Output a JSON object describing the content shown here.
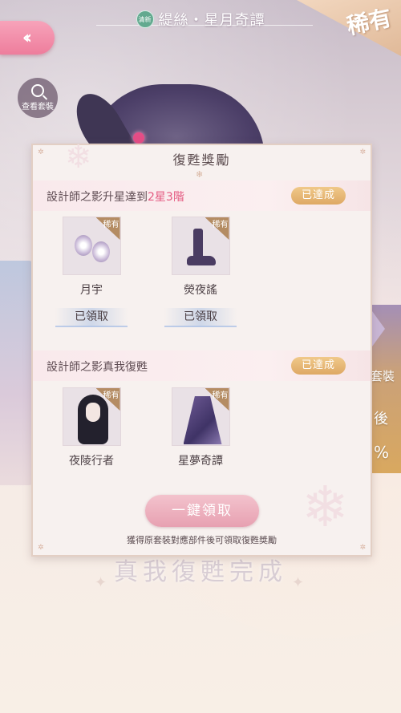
{
  "header": {
    "badge_label": "清新",
    "title": "緹絲・星月奇譚",
    "rarity_label": "稀有",
    "view_set_label": "查看套裝",
    "back_icon": "double-chevron-left-icon"
  },
  "background": {
    "right_labels": [
      "套裝",
      "後",
      "%"
    ],
    "bottom_text": "真我復甦完成"
  },
  "modal": {
    "title": "復甦獎勵",
    "sections": [
      {
        "title_prefix": "設計師之影升星達到",
        "title_highlight": "2星3階",
        "status": "已達成",
        "items": [
          {
            "name": "月宇",
            "rarity": "稀有",
            "claimed_label": "已領取",
            "icon": "earring-icon"
          },
          {
            "name": "熒夜謠",
            "rarity": "稀有",
            "claimed_label": "已領取",
            "icon": "boots-icon"
          }
        ]
      },
      {
        "title_prefix": "設計師之影真我復甦",
        "title_highlight": "",
        "status": "已達成",
        "items": [
          {
            "name": "夜陵行者",
            "rarity": "稀有",
            "icon": "hairstyle-icon"
          },
          {
            "name": "星夢奇譚",
            "rarity": "稀有",
            "icon": "dress-icon"
          }
        ]
      }
    ],
    "claim_all_label": "一鍵領取",
    "hint": "獲得原套裝對應部件後可領取復甦獎勵"
  },
  "colors": {
    "accent_pink": "#e45a81",
    "achieved_gold": "#dea864",
    "back_button": "#ee7d9c"
  }
}
